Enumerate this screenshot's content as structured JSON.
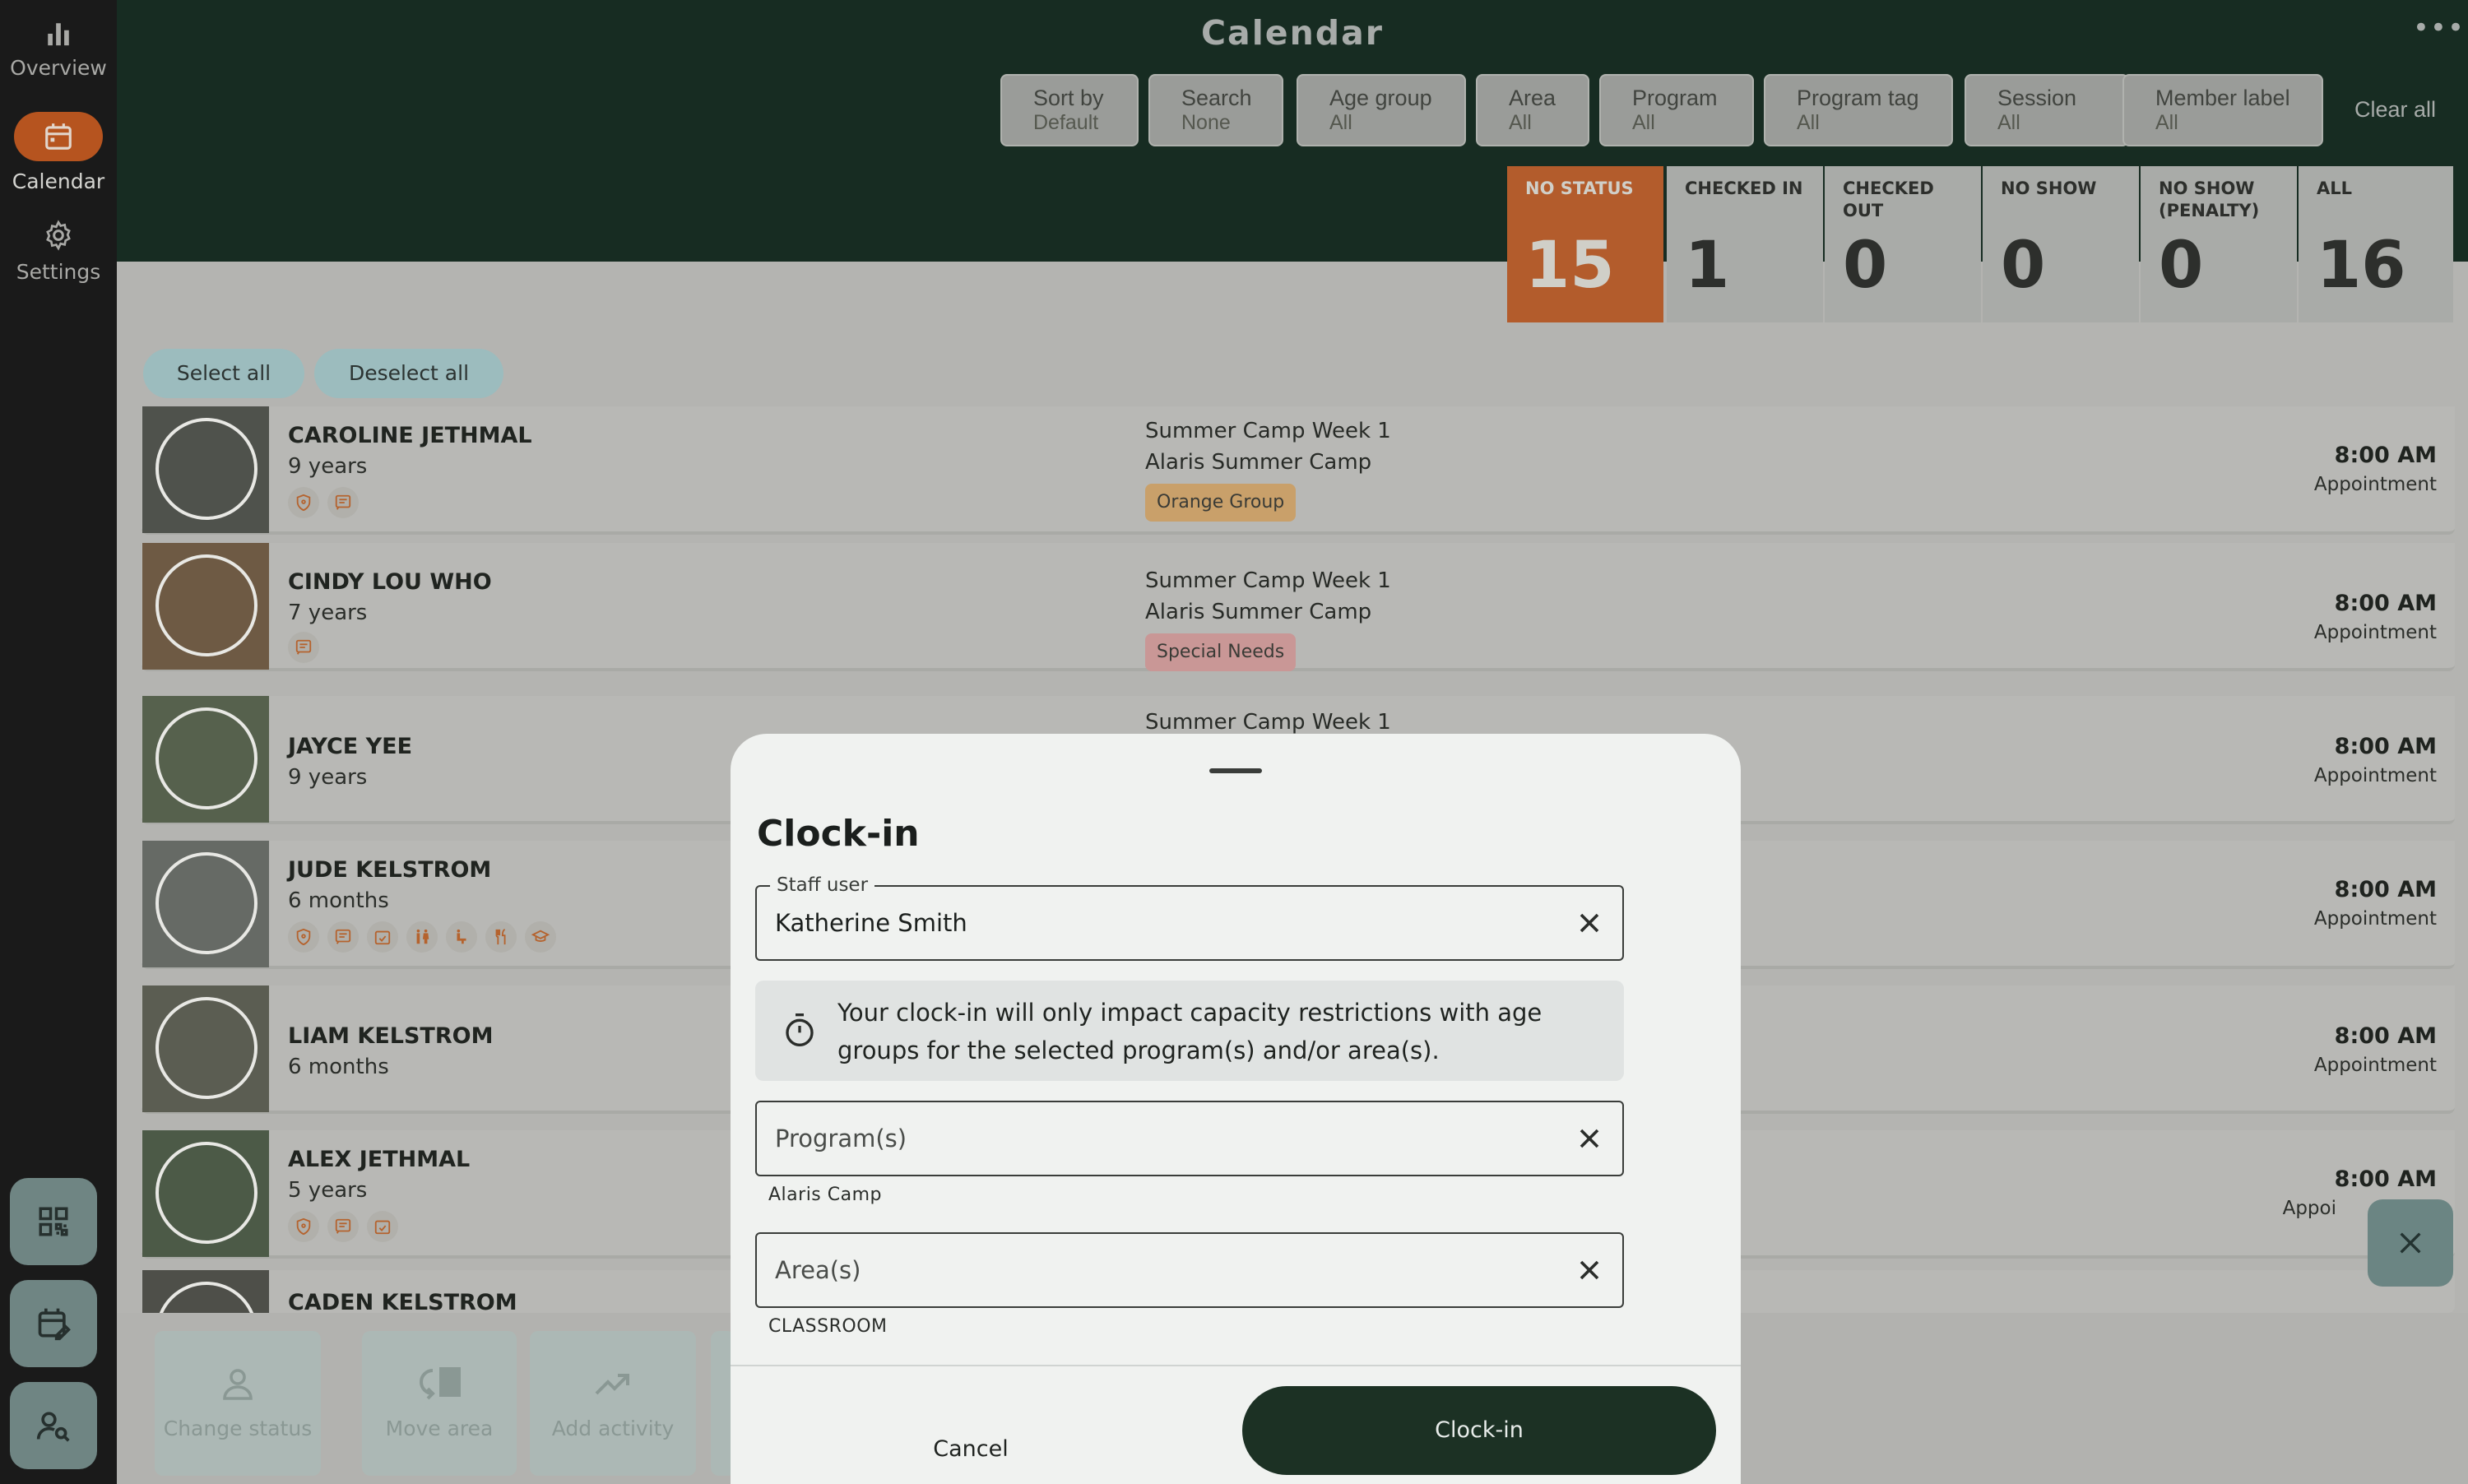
{
  "sidebar": {
    "items": [
      {
        "label": "Overview",
        "icon": "bar-chart-icon",
        "active": false
      },
      {
        "label": "Calendar",
        "icon": "calendar-icon",
        "active": true
      },
      {
        "label": "Settings",
        "icon": "gear-icon",
        "active": false
      }
    ],
    "bottom_buttons": [
      {
        "icon": "qr-code-icon"
      },
      {
        "icon": "calendar-edit-icon"
      },
      {
        "icon": "user-search-icon"
      }
    ]
  },
  "header": {
    "title": "Calendar",
    "more": "•••",
    "filters": [
      {
        "label": "Sort by",
        "value": "Default"
      },
      {
        "label": "Search",
        "value": "None"
      },
      {
        "label": "Age group",
        "value": "All"
      },
      {
        "label": "Area",
        "value": "All"
      },
      {
        "label": "Program",
        "value": "All"
      },
      {
        "label": "Program tag",
        "value": "All"
      },
      {
        "label": "Session",
        "value": "All"
      },
      {
        "label": "Member label",
        "value": "All"
      }
    ],
    "clear_all": "Clear all"
  },
  "status_tabs": [
    {
      "label": "NO STATUS",
      "count": "15",
      "active": true
    },
    {
      "label": "CHECKED IN",
      "count": "1"
    },
    {
      "label": "CHECKED OUT",
      "count": "0"
    },
    {
      "label": "NO SHOW",
      "count": "0"
    },
    {
      "label": "NO SHOW (PENALTY)",
      "count": "0"
    },
    {
      "label": "ALL",
      "count": "16"
    }
  ],
  "selection": {
    "select_all": "Select all",
    "deselect_all": "Deselect all"
  },
  "roster": [
    {
      "name": "CAROLINE JETHMAL",
      "age": "9 years",
      "session": "Summer Camp Week 1",
      "program": "Alaris Summer Camp",
      "tag": "Orange Group",
      "tag_color": "#c9a06a",
      "time": "8:00 AM",
      "type": "Appointment"
    },
    {
      "name": "CINDY LOU WHO",
      "age": "7 years",
      "session": "Summer Camp Week 1",
      "program": "Alaris Summer Camp",
      "tag": "Special Needs",
      "tag_color": "#c99796",
      "time": "8:00 AM",
      "type": "Appointment"
    },
    {
      "name": "JAYCE YEE",
      "age": "9 years",
      "session": "Summer Camp Week 1",
      "time": "8:00 AM",
      "type": "Appointment"
    },
    {
      "name": "JUDE KELSTROM",
      "age": "6 months",
      "time": "8:00 AM",
      "type": "Appointment"
    },
    {
      "name": "LIAM KELSTROM",
      "age": "6 months",
      "time": "8:00 AM",
      "type": "Appointment"
    },
    {
      "name": "ALEX JETHMAL",
      "age": "5 years",
      "time": "8:00 AM",
      "type": "Appoi"
    },
    {
      "name": "CADEN KELSTROM"
    }
  ],
  "actions": [
    {
      "label": "Change status",
      "icon": "person-icon"
    },
    {
      "label": "Move area",
      "icon": "move-area-icon"
    },
    {
      "label": "Add activity",
      "icon": "trending-up-icon"
    }
  ],
  "dialog": {
    "title": "Clock-in",
    "staff_label": "Staff user",
    "staff_value": "Katherine Smith",
    "info": "Your clock-in will only impact capacity restrictions with age groups for the selected program(s) and/or area(s).",
    "program_placeholder": "Program(s)",
    "program_helper": "Alaris Camp",
    "area_placeholder": "Area(s)",
    "area_helper": "CLASSROOM",
    "cancel": "Cancel",
    "confirm": "Clock-in"
  },
  "colors": {
    "header_bg": "#172c22",
    "active_status": "#b35c2c",
    "primary_button": "#1c3124",
    "sidebar_bg": "#1a1a1a"
  }
}
